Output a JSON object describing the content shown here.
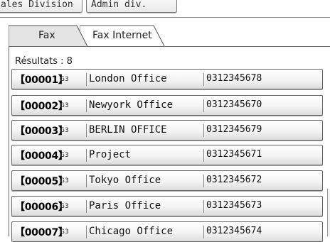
{
  "top_buttons": [
    "ales Division",
    "Admin div."
  ],
  "tabs": [
    {
      "label": "Fax",
      "selected": true
    },
    {
      "label": "Fax Internet",
      "selected": false
    }
  ],
  "results_label": "Résultats : 8",
  "entries": [
    {
      "reg": "【00001】",
      "type": "G3",
      "name": "London Office",
      "number": "0312345678"
    },
    {
      "reg": "【00002】",
      "type": "G3",
      "name": "Newyork Office",
      "number": "0312345670"
    },
    {
      "reg": "【00003】",
      "type": "G3",
      "name": "BERLIN OFFICE",
      "number": "0312345679"
    },
    {
      "reg": "【00004】",
      "type": "G3",
      "name": "Project",
      "number": "0312345671"
    },
    {
      "reg": "【00005】",
      "type": "G3",
      "name": "Tokyo Office",
      "number": "0312345672"
    },
    {
      "reg": "【00006】",
      "type": "G3",
      "name": "Paris Office",
      "number": "0312345673"
    },
    {
      "reg": "【00007】",
      "type": "G3",
      "name": "Chicago Office",
      "number": "0312345674"
    }
  ],
  "colors": {
    "border": "#666666",
    "row_gradient_top": "#ffffff",
    "row_gradient_bottom": "#dcdcdc",
    "background": "#ffffff"
  }
}
